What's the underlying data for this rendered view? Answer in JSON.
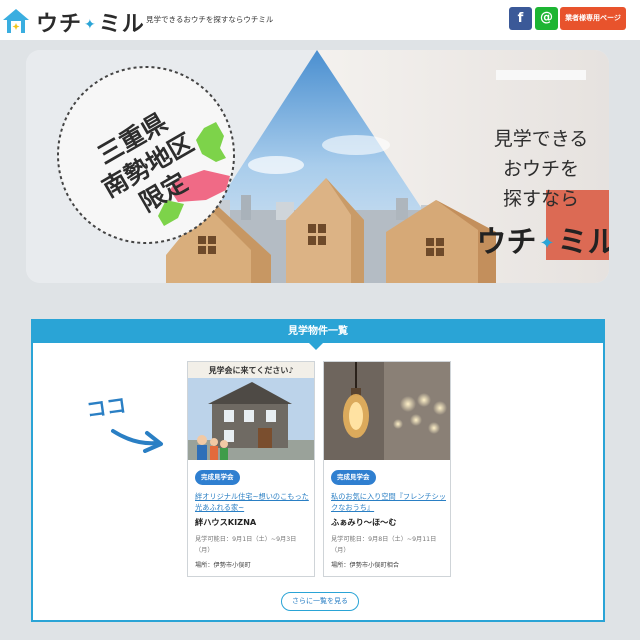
{
  "header": {
    "logo_text_left": "ウチ",
    "logo_dot": "✦",
    "logo_text_right": "ミル",
    "tagline": "見学できるおウチを探すならウチミル",
    "facebook_label": "f",
    "line_label": "@",
    "vendor_button": "業者様専用ページ"
  },
  "hero": {
    "region_lines": [
      "三重県",
      "南勢地区",
      "限定"
    ],
    "copy_lines": [
      "見学できる",
      "おウチを",
      "探すなら"
    ],
    "brand_left": "ウチ",
    "brand_dot": "✦",
    "brand_right": "ミル"
  },
  "listing": {
    "title": "見学物件一覧",
    "annotation": "ココ",
    "more_button": "さらに一覧を見る",
    "cards": [
      {
        "banner": "見学会に来てください♪",
        "badge": "完成見学会",
        "title": "絆オリジナル住宅~想いのこもった光あふれる家~",
        "company": "絆ハウスKIZNA",
        "dates": "見学可能日：9月1日（土）~9月3日（月）",
        "place": "場所：伊勢市小俣町"
      },
      {
        "badge": "完成見学会",
        "title": "私のお気に入り空間『フレンチシックなおうち』",
        "company": "ふぁみり～ほ～む",
        "dates": "見学可能日：9月8日（土）~9月11日（月）",
        "place": "場所：伊勢市小俣町相合"
      }
    ]
  },
  "colors": {
    "accent": "#2aa4d6",
    "vendor": "#e8532c",
    "facebook": "#3b5998",
    "line": "#1db533",
    "badge": "#2f7fd0"
  }
}
